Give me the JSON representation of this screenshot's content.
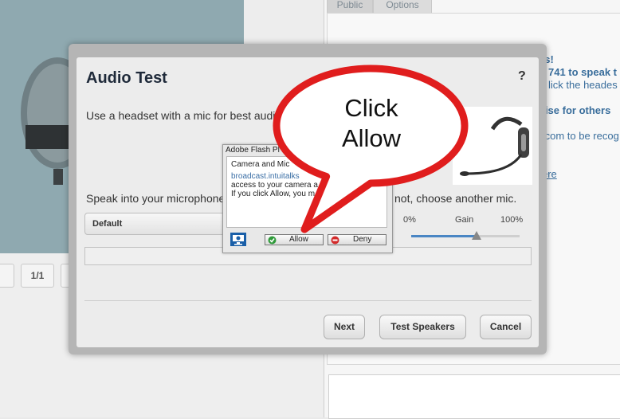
{
  "background": {
    "tabs": [
      "Public",
      "Options"
    ],
    "pager": "1/1",
    "right_lines": [
      "es!",
      "741 to speak t",
      "lick the heades",
      "oise for others",
      ".com to be recog",
      "ere"
    ]
  },
  "modal": {
    "title": "Audio Test",
    "help": "?",
    "headset_hint": "Use a headset with a mic for best audio",
    "speak_prompt_start": "Speak into your microphone",
    "speak_prompt_end": "not, choose another mic.",
    "mic_selected": "Default",
    "gain": {
      "label": "Gain",
      "min_label": "0%",
      "max_label": "100%",
      "value_pct": 60
    },
    "buttons": {
      "next": "Next",
      "test_speakers": "Test Speakers",
      "cancel": "Cancel"
    }
  },
  "flash": {
    "title": "Adobe Flash Pl",
    "heading": "Camera and Mic",
    "domain": "broadcast.intuitalks",
    "line1": "access to your camera a",
    "line2": "If you click Allow, you m",
    "allow": "Allow",
    "deny": "Deny"
  },
  "callout": {
    "line1": "Click",
    "line2": "Allow",
    "color": "#e01d1d"
  },
  "colors": {
    "link": "#3a6e9c",
    "slider_fill": "#4a86c4",
    "modal_frame": "#b5b5b5"
  }
}
